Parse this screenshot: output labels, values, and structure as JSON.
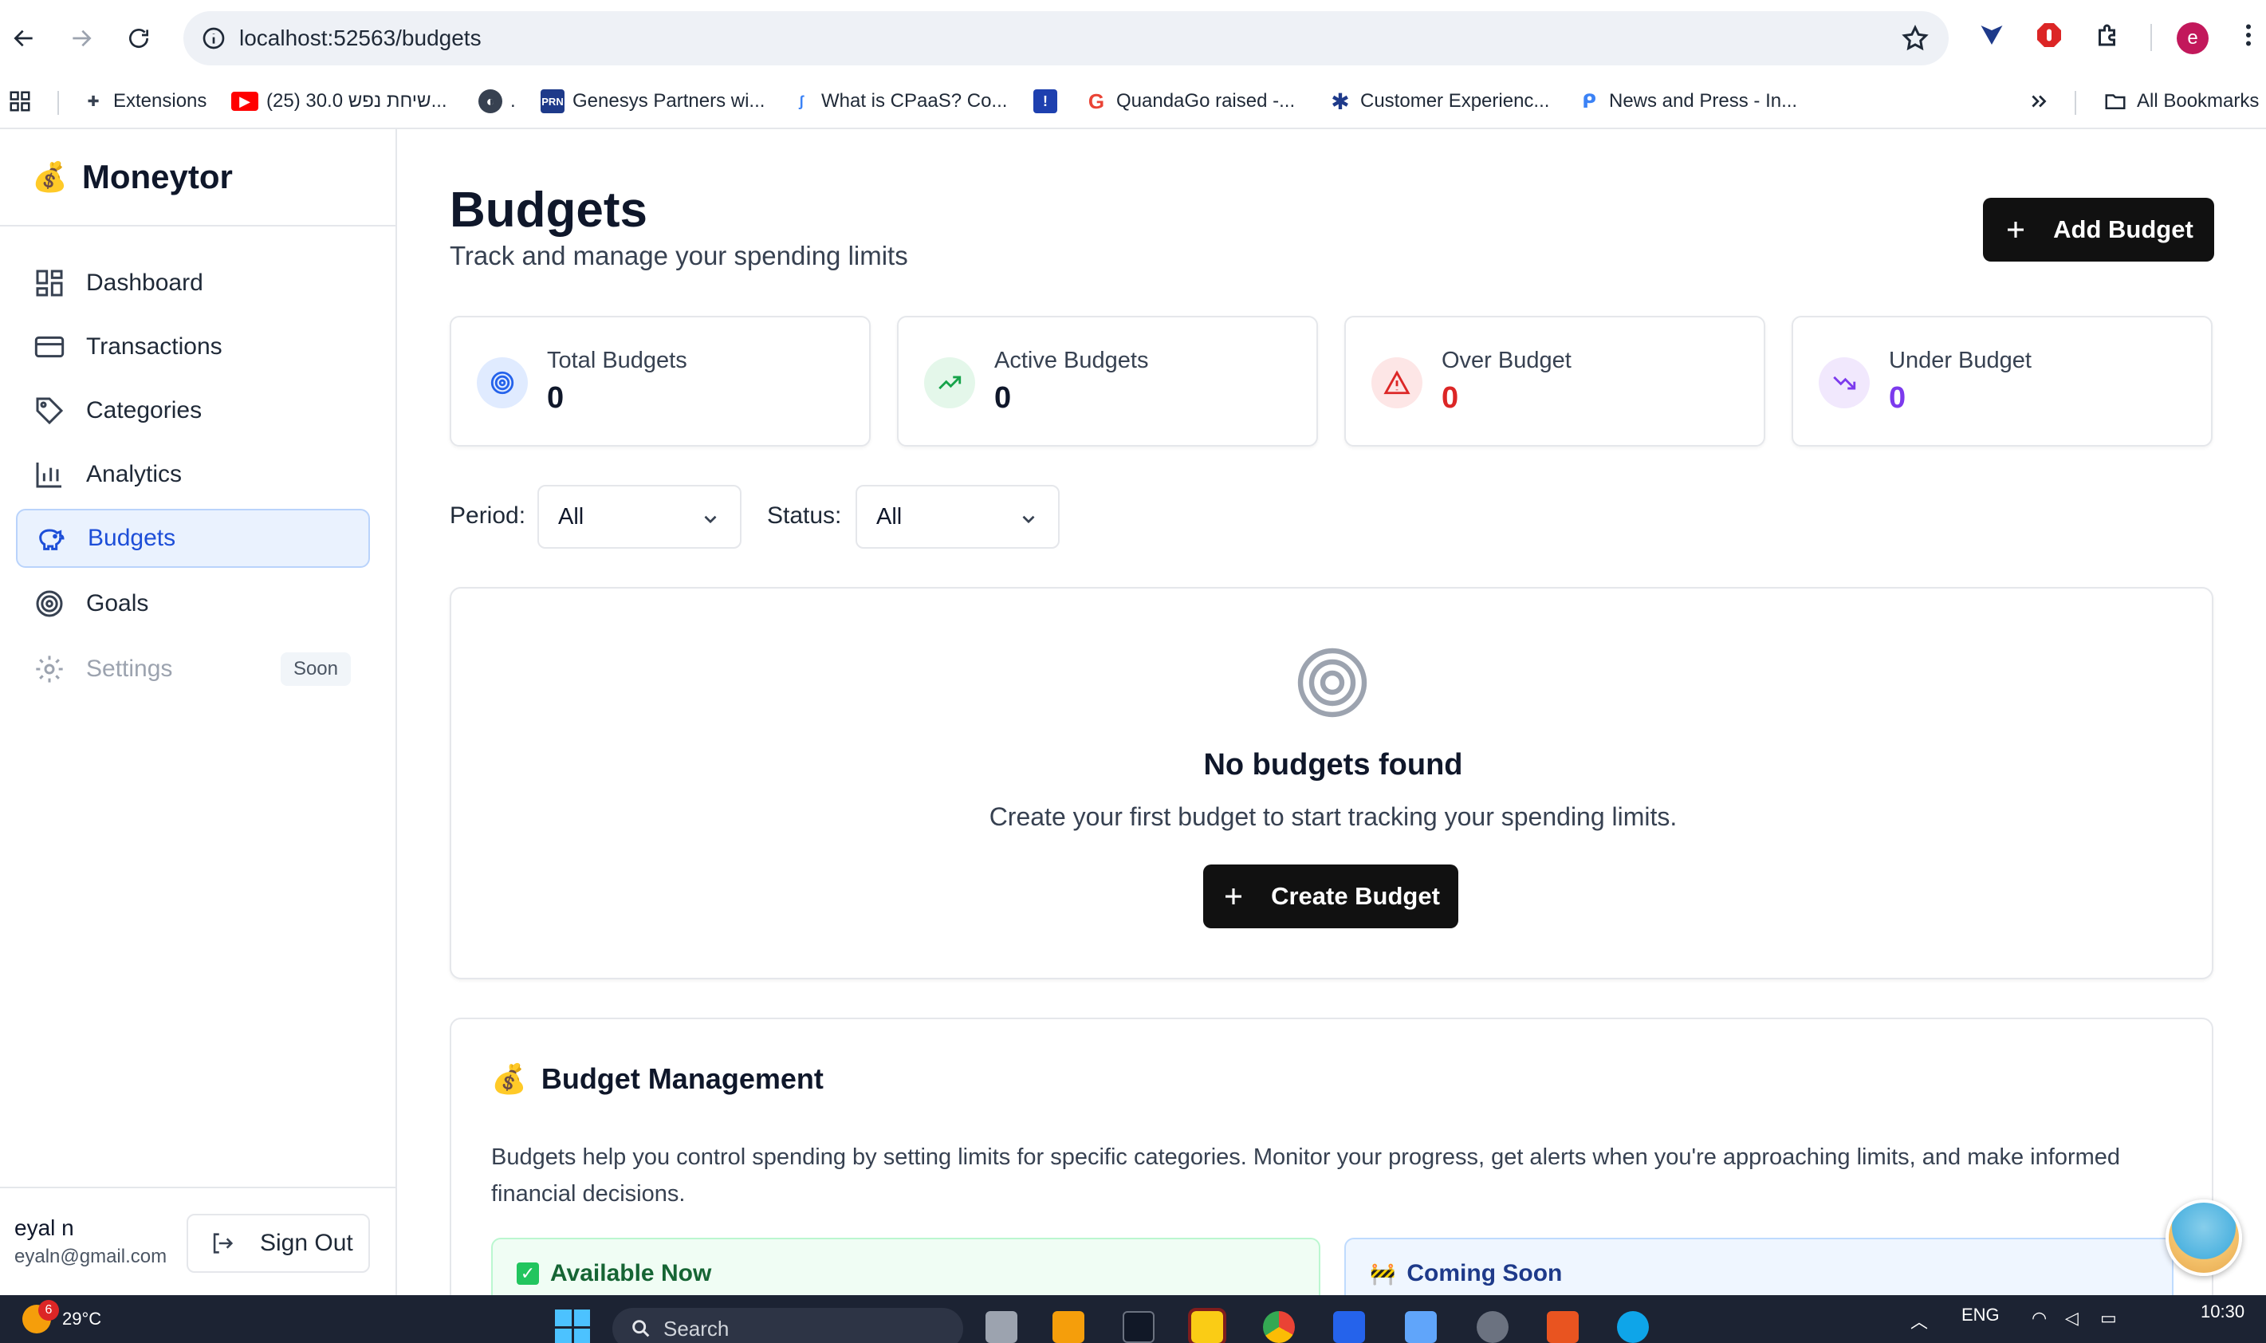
{
  "browser": {
    "url": "localhost:52563/budgets",
    "profile_initial": "e",
    "bookmarks": [
      {
        "label": "Extensions",
        "icon": "puzzle-icon"
      },
      {
        "label": "(25) שיחת נפש 30.0...",
        "icon": "youtube-icon"
      },
      {
        "label": ".",
        "icon": "globe-icon"
      },
      {
        "label": "Genesys Partners wi...",
        "icon": "prn-icon"
      },
      {
        "label": "What is CPaaS? Co...",
        "icon": "bird-icon"
      },
      {
        "label": "",
        "icon": "exclamation-icon"
      },
      {
        "label": "QuandaGo raised -...",
        "icon": "google-icon"
      },
      {
        "label": "Customer Experienc...",
        "icon": "star-icon"
      },
      {
        "label": "News and Press - In...",
        "icon": "chat-icon"
      }
    ],
    "all_bookmarks": "All Bookmarks"
  },
  "sidebar": {
    "brand": "Moneytor",
    "brand_icon": "money-bag-icon",
    "items": [
      {
        "label": "Dashboard",
        "icon": "dashboard-icon",
        "active": false
      },
      {
        "label": "Transactions",
        "icon": "credit-card-icon",
        "active": false
      },
      {
        "label": "Categories",
        "icon": "tag-icon",
        "active": false
      },
      {
        "label": "Analytics",
        "icon": "bar-chart-icon",
        "active": false
      },
      {
        "label": "Budgets",
        "icon": "piggy-bank-icon",
        "active": true
      },
      {
        "label": "Goals",
        "icon": "target-icon",
        "active": false
      },
      {
        "label": "Settings",
        "icon": "gear-icon",
        "active": false,
        "badge": "Soon"
      }
    ],
    "user": {
      "name": "eyal n",
      "email": "eyaln@gmail.com"
    },
    "sign_out": "Sign Out"
  },
  "header": {
    "title": "Budgets",
    "subtitle": "Track and manage your spending limits",
    "add_button": "Add Budget"
  },
  "stats": [
    {
      "label": "Total Budgets",
      "value": "0",
      "color": "#0f172a",
      "icon": "target-icon",
      "icon_bg": "#e0ebff",
      "icon_color": "#2563eb"
    },
    {
      "label": "Active Budgets",
      "value": "0",
      "color": "#0f172a",
      "icon": "trending-up-icon",
      "icon_bg": "#e4f7ea",
      "icon_color": "#16a34a"
    },
    {
      "label": "Over Budget",
      "value": "0",
      "color": "#dc2626",
      "icon": "alert-triangle-icon",
      "icon_bg": "#fde6e6",
      "icon_color": "#dc2626"
    },
    {
      "label": "Under Budget",
      "value": "0",
      "color": "#7c3aed",
      "icon": "trending-down-icon",
      "icon_bg": "#f1e8fd",
      "icon_color": "#7c3aed"
    }
  ],
  "filters": {
    "period_label": "Period:",
    "period_value": "All",
    "status_label": "Status:",
    "status_value": "All"
  },
  "empty": {
    "title": "No budgets found",
    "text": "Create your first budget to start tracking your spending limits.",
    "button": "Create Budget"
  },
  "management": {
    "title": "Budget Management",
    "description": "Budgets help you control spending by setting limits for specific categories. Monitor your progress, get alerts when you're approaching limits, and make informed financial decisions.",
    "available_title": "Available Now",
    "coming_title": "Coming Soon"
  },
  "taskbar": {
    "weather_badge": "6",
    "temperature": "29°C",
    "search": "Search",
    "language": "ENG",
    "time": "10:30"
  }
}
